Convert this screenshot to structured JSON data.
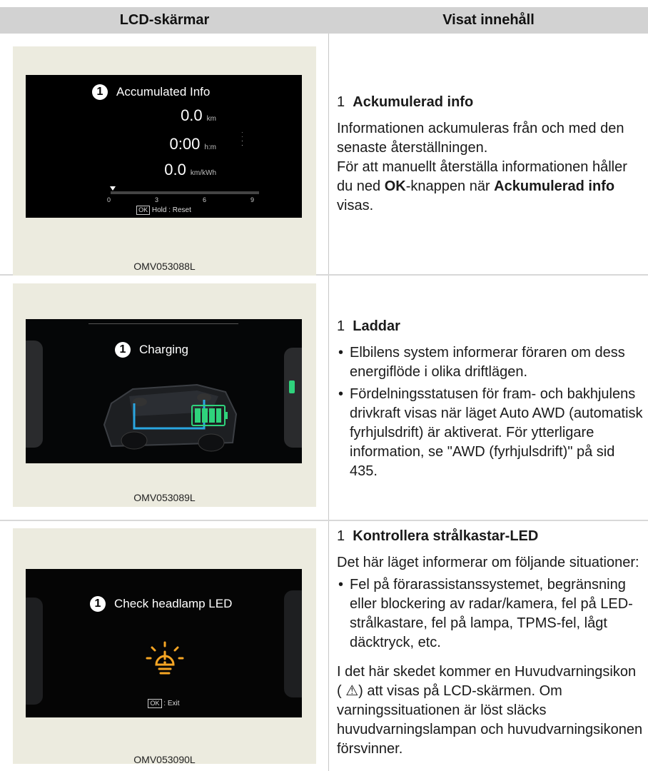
{
  "header": {
    "col1": "LCD-skärmar",
    "col2": "Visat innehåll"
  },
  "rows": [
    {
      "screen": {
        "num": "1",
        "title": "Accumulated Info",
        "values": [
          {
            "value": "0.0",
            "unit": "km"
          },
          {
            "value": "0:00",
            "unit": "h:m"
          },
          {
            "value": "0.0",
            "unit": "km/kWh"
          }
        ],
        "scale": [
          "0",
          "3",
          "6",
          "9"
        ],
        "ok_label": "OK",
        "hint": "Hold : Reset"
      },
      "caption": "OMV053088L",
      "desc": {
        "num": "1",
        "heading": "Ackumulerad info",
        "p1": "Informationen ackumuleras från och med den senaste återställningen.",
        "p2_a": "För att manuellt återställa informationen håller du ned ",
        "p2_b": "OK",
        "p2_c": "-knappen när ",
        "p2_d": "Ackumulerad info",
        "p2_e": " visas."
      }
    },
    {
      "screen": {
        "num": "1",
        "title": "Charging"
      },
      "caption": "OMV053089L",
      "desc": {
        "num": "1",
        "heading": "Laddar",
        "b1": "Elbilens system informerar föraren om dess energiflöde i olika driftlägen.",
        "b2_a": "Fördelningsstatusen för fram- och bakhjulens drivkraft visas när läget Auto AWD (automatisk fyrhjulsdrift) är aktiverat. För ytterligare information, se \"AWD (fyrhjulsdrift)\"",
        "b2_b": " på sid 435."
      }
    },
    {
      "screen": {
        "num": "1",
        "title": "Check headlamp LED",
        "ok_label": "OK",
        "hint": ": Exit"
      },
      "caption": "OMV053090L",
      "desc": {
        "num": "1",
        "heading": "Kontrollera strålkastar-LED",
        "p1": "Det här läget informerar om följande situationer:",
        "b1": "Fel på förarassistanssystemet, begränsning eller blockering av radar/kamera, fel på LED-strålkastare, fel på lampa, TPMS-fel, lågt däcktryck, etc.",
        "p2_a": "I det här skedet kommer en Huvudvarningsikon ( ",
        "p2_b": "⚠",
        "p2_c": ") att visas på LCD-skärmen. Om varningssituationen är löst släcks huvudvarningslampan och huvudvarningsikonen försvinner."
      }
    }
  ],
  "colors": {
    "header_bg": "#d2d2d2",
    "image_bg": "#ecebdf",
    "battery": "#2fd37c",
    "warning": "#f5a524"
  },
  "icons": [
    "car-icon",
    "battery-icon",
    "headlamp-warning-icon",
    "warning-triangle-icon"
  ]
}
